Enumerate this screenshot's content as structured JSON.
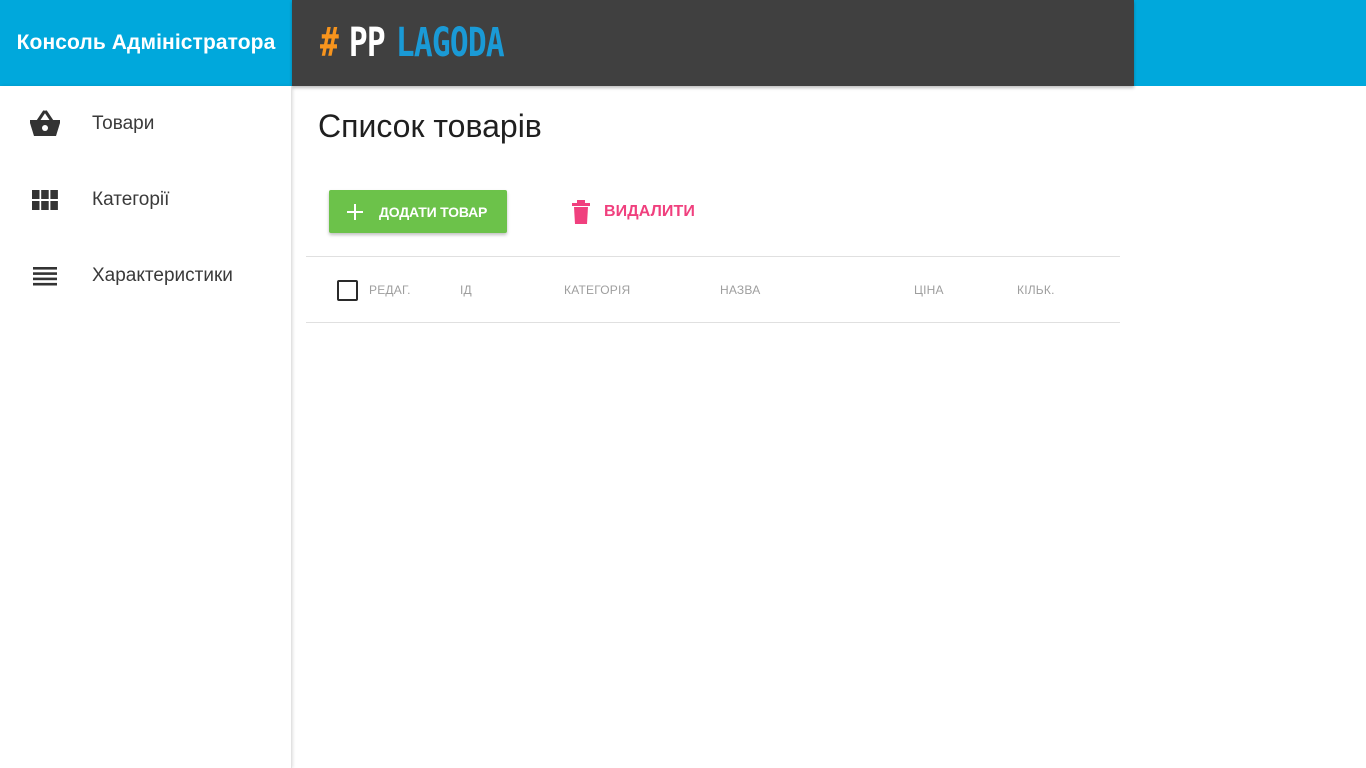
{
  "header": {
    "console_title": "Консоль Адміністратора",
    "logo": {
      "hash": "#",
      "pp": "PP",
      "lagoda": "LAGODA"
    }
  },
  "colors": {
    "header_bg": "#00a8dc",
    "logo_bar_bg": "#404040",
    "add_button": "#6cc24a",
    "delete_text": "#f0407e",
    "logo_hash": "#f7941d",
    "logo_lagoda": "#1a9ad6"
  },
  "sidebar": {
    "items": [
      {
        "label": "Товари",
        "icon": "basket-icon"
      },
      {
        "label": "Категорії",
        "icon": "grid-icon"
      },
      {
        "label": "Характеристики",
        "icon": "list-icon"
      }
    ]
  },
  "main": {
    "title": "Список товарів",
    "add_label": "ДОДАТИ ТОВАР",
    "delete_label": "ВИДАЛИТИ",
    "table": {
      "columns": [
        "РЕДАГ.",
        "ІД",
        "КАТЕГОРІЯ",
        "НАЗВА",
        "ЦІНА",
        "КІЛЬК."
      ],
      "rows": []
    }
  }
}
